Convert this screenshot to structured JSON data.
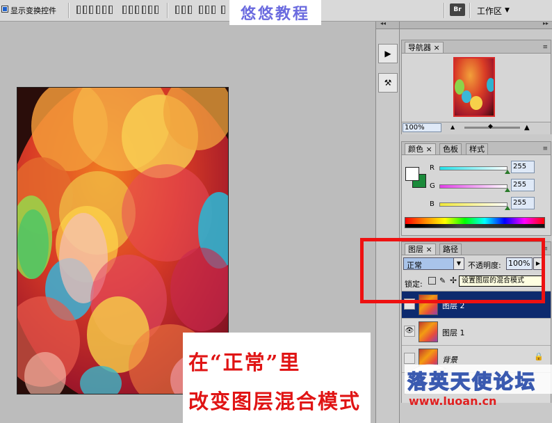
{
  "optbar": {
    "show_transform_label": "显示变换控件",
    "workspace_label": "工作区",
    "bridge_icon_label": "Br"
  },
  "watermark_top": "悠悠教程",
  "navigator": {
    "tab_label": "导航器",
    "zoom_value": "100%"
  },
  "color": {
    "tabs": [
      "颜色",
      "色板",
      "样式"
    ],
    "channels": [
      {
        "label": "R",
        "value": "255",
        "track_color": "#22e0e8"
      },
      {
        "label": "G",
        "value": "255",
        "track_color": "#e23ee8"
      },
      {
        "label": "B",
        "value": "255",
        "track_color": "#f0e83a"
      }
    ],
    "foreground": "#ffffff",
    "background": "#1a8a3a"
  },
  "layers": {
    "tabs": [
      "图层",
      "路径"
    ],
    "blend_mode": "正常",
    "opacity_label": "不透明度:",
    "opacity_value": "100%",
    "lock_label": "锁定:",
    "tooltip": "设置图层的混合模式",
    "items": [
      {
        "name": "图层 2",
        "selected": true,
        "visible": false
      },
      {
        "name": "图层 1",
        "selected": false,
        "visible": true
      },
      {
        "name": "背景",
        "selected": false,
        "visible": false,
        "locked": true
      }
    ]
  },
  "caption": {
    "line1": "在“正常”里",
    "line2": "改变图层混合模式"
  },
  "forum": {
    "name": "落英天使论坛",
    "url": "www.luoan.cn"
  }
}
